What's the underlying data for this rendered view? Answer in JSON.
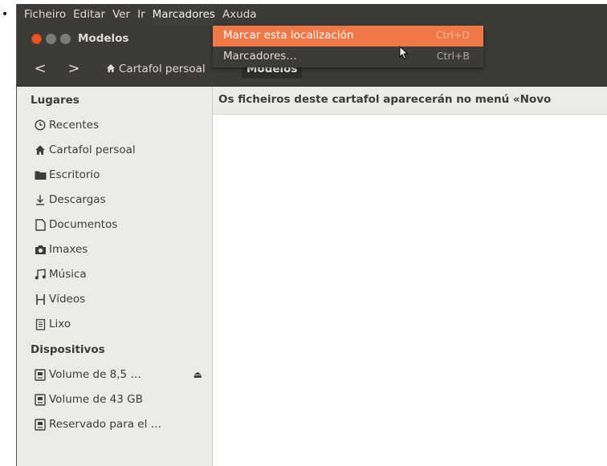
{
  "bullet": "•",
  "menubar": {
    "items": [
      "Ficheiro",
      "Editar",
      "Ver",
      "Ir",
      "Marcadores",
      "Axuda"
    ],
    "active_index": 4
  },
  "window": {
    "title": "Modelos"
  },
  "toolbar": {
    "back": "<",
    "forward": ">",
    "breadcrumbs": [
      "Cartafol persoal",
      "Modelos"
    ]
  },
  "dropdown": {
    "items": [
      {
        "label": "Marcar esta localización",
        "shortcut": "Ctrl+D",
        "highlighted": true
      },
      {
        "label": "Marcadores…",
        "shortcut": "Ctrl+B",
        "highlighted": false
      }
    ]
  },
  "sidebar": {
    "places_heading": "Lugares",
    "places": [
      {
        "label": "Recentes",
        "icon": "clock-icon"
      },
      {
        "label": "Cartafol persoal",
        "icon": "home-icon"
      },
      {
        "label": "Escritorio",
        "icon": "folder-icon"
      },
      {
        "label": "Descargas",
        "icon": "download-icon"
      },
      {
        "label": "Documentos",
        "icon": "document-icon"
      },
      {
        "label": "Imaxes",
        "icon": "camera-icon"
      },
      {
        "label": "Música",
        "icon": "music-icon"
      },
      {
        "label": "Vídeos",
        "icon": "film-icon"
      },
      {
        "label": "Lixo",
        "icon": "trash-icon"
      }
    ],
    "devices_heading": "Dispositivos",
    "devices": [
      {
        "label": "Volume de 8,5 …",
        "icon": "drive-icon",
        "eject": true
      },
      {
        "label": "Volume de 43 GB",
        "icon": "drive-icon",
        "eject": false
      },
      {
        "label": "Reservado para el …",
        "icon": "drive-icon",
        "eject": false
      }
    ]
  },
  "content": {
    "info_text": "Os ficheiros deste cartafol aparecerán no menú «Novo"
  },
  "colors": {
    "accent": "#f07746",
    "dark_chrome": "#3c3b37",
    "sidebar_bg": "#ecebe8"
  }
}
